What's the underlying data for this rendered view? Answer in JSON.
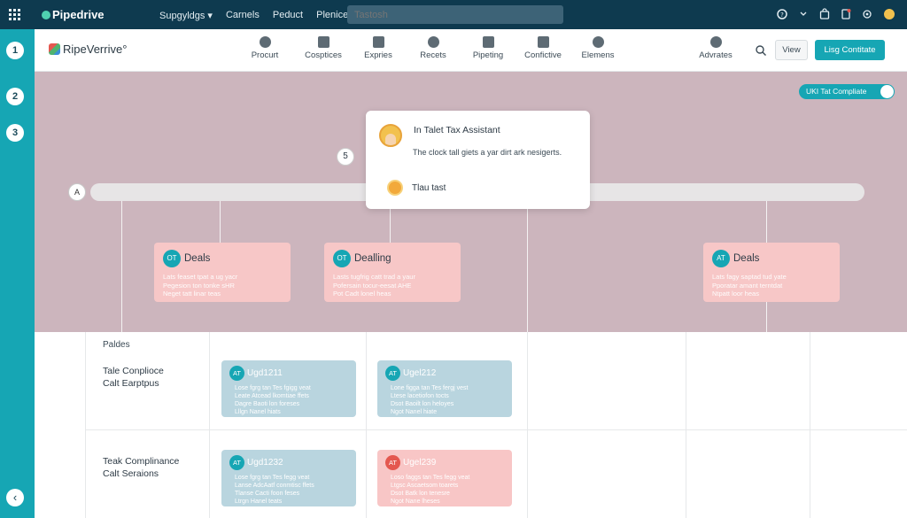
{
  "topbar": {
    "brand": "Pipedrive",
    "nav": [
      "Supgyldgs ▾",
      "Carnels",
      "Peduct",
      "Plenices"
    ],
    "search_placeholder": "Tastosh"
  },
  "rail": {
    "steps": [
      "1",
      "2",
      "3"
    ],
    "collapse": "‹"
  },
  "app_header": {
    "logo": "RipeVerrive°",
    "nav": [
      "Procurt",
      "Cosptices",
      "Expries",
      "Recets",
      "Pipeting",
      "Confictive",
      "Elemens"
    ],
    "advanced": "Advrates",
    "view_label": "View",
    "primary_label": "Lisg Contitate"
  },
  "pink_area": {
    "toggle_label": "UKI Tat Compliate",
    "timeline_start": "A",
    "popup_step": "5"
  },
  "popup": {
    "title": "In Talet Tax Assistant",
    "description": "The clock tall giets a yar dirt ark nesigerts.",
    "action": "Tlau tast"
  },
  "deal_cards": [
    {
      "badge": "OT",
      "title": "Deals",
      "body": [
        "Lats feaset tpat a ug yacr",
        "Pegesion ton tonke sHR",
        "Neget tatt linar teas"
      ]
    },
    {
      "badge": "OT",
      "title": "Dealling",
      "body": [
        "Lasts tugfrig catt trad a yaur",
        "Pofersain tocur-eesat AHE",
        "Pot Cadt lonel heas"
      ]
    },
    {
      "badge": "AT",
      "title": "Deals",
      "body": [
        "Lats fagy saptad tud yate",
        "Pporatar amant terntdat",
        "Ntpatt loor heas"
      ]
    }
  ],
  "board": {
    "phase_label": "Paldes",
    "rows": [
      {
        "label": [
          "Tale Conplioce",
          "Calt Earptpus"
        ]
      },
      {
        "label": [
          "Teak Complinance",
          "Calt Seraions"
        ]
      }
    ],
    "cards": [
      {
        "badge": "AT",
        "title": "Ugd1211",
        "color": "blue",
        "body": [
          "Lose fgrg tan Tes fgigg veat",
          "Leate Atcead lkomtiae ffets",
          "Dagre Baoti lon foreses",
          "Lllgn Nanel hiats"
        ]
      },
      {
        "badge": "AT",
        "title": "Ugel212",
        "color": "blue",
        "body": [
          "Lone figga tan Tes fergj vest",
          "Ltese lacetiofon tocts",
          "Dsot Baoilt lon heloyes",
          "Ngot Nanel hiate"
        ]
      },
      {
        "badge": "AT",
        "title": "Ugd1232",
        "color": "blue",
        "body": [
          "Lose fgrg tan Tes fegg veat",
          "Lanse AdcAatf conmtisc ffets",
          "Tlanse Cacti foon feses",
          "Ltrgn Hanel teats"
        ]
      },
      {
        "badge": "AT",
        "title": "Ugel239",
        "color": "pink",
        "body": [
          "Loso faggs tan Tes fegg veat",
          "Ltgsc Ascaetsom toarets",
          "Dsot Batk lon tenesre",
          "Ngot Nane lheses"
        ]
      }
    ]
  },
  "colors": {
    "accent": "#16a6b4",
    "topbar": "#0e3a4f",
    "pink_bg": "#ccb5bd",
    "deal_card": "#f7c7c7",
    "task_blue": "#b9d5df",
    "task_pink": "#f8c6c6"
  },
  "icons": [
    "grid-icon",
    "help-icon",
    "bag-icon",
    "bell-icon",
    "user-icon",
    "search-icon",
    "sun-icon",
    "avatar-icon"
  ]
}
